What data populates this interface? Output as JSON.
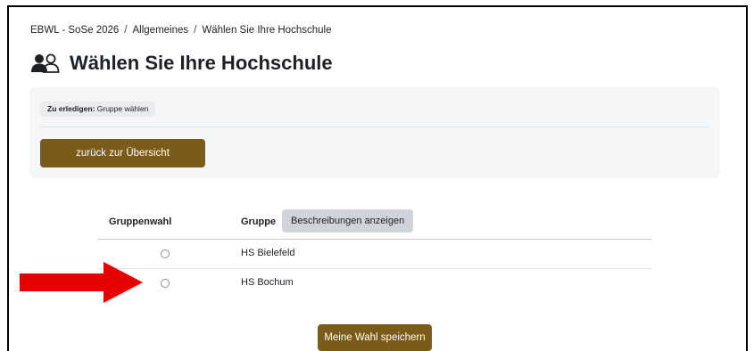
{
  "breadcrumb": {
    "items": [
      "EBWL - SoSe 2026",
      "Allgemeines",
      "Wählen Sie Ihre Hochschule"
    ],
    "separator": "/"
  },
  "page": {
    "title": "Wählen Sie Ihre Hochschule",
    "title_icon": "people-icon"
  },
  "todo": {
    "label": "Zu erledigen:",
    "text": "Gruppe wählen"
  },
  "buttons": {
    "back": "zurück zur Übersicht",
    "show_descriptions": "Beschreibungen anzeigen",
    "save": "Meine Wahl speichern"
  },
  "table": {
    "headers": [
      "Gruppenwahl",
      "Gruppe"
    ],
    "rows": [
      {
        "group": "HS Bielefeld",
        "selected": false
      },
      {
        "group": "HS Bochum",
        "selected": false
      }
    ]
  },
  "annotation": {
    "type": "arrow",
    "color": "#e60000",
    "points_to": "HS Bochum"
  },
  "colors": {
    "primary_button": "#7a5b1a",
    "secondary_button": "#ced4da",
    "panel_bg": "#f5f6f8"
  }
}
